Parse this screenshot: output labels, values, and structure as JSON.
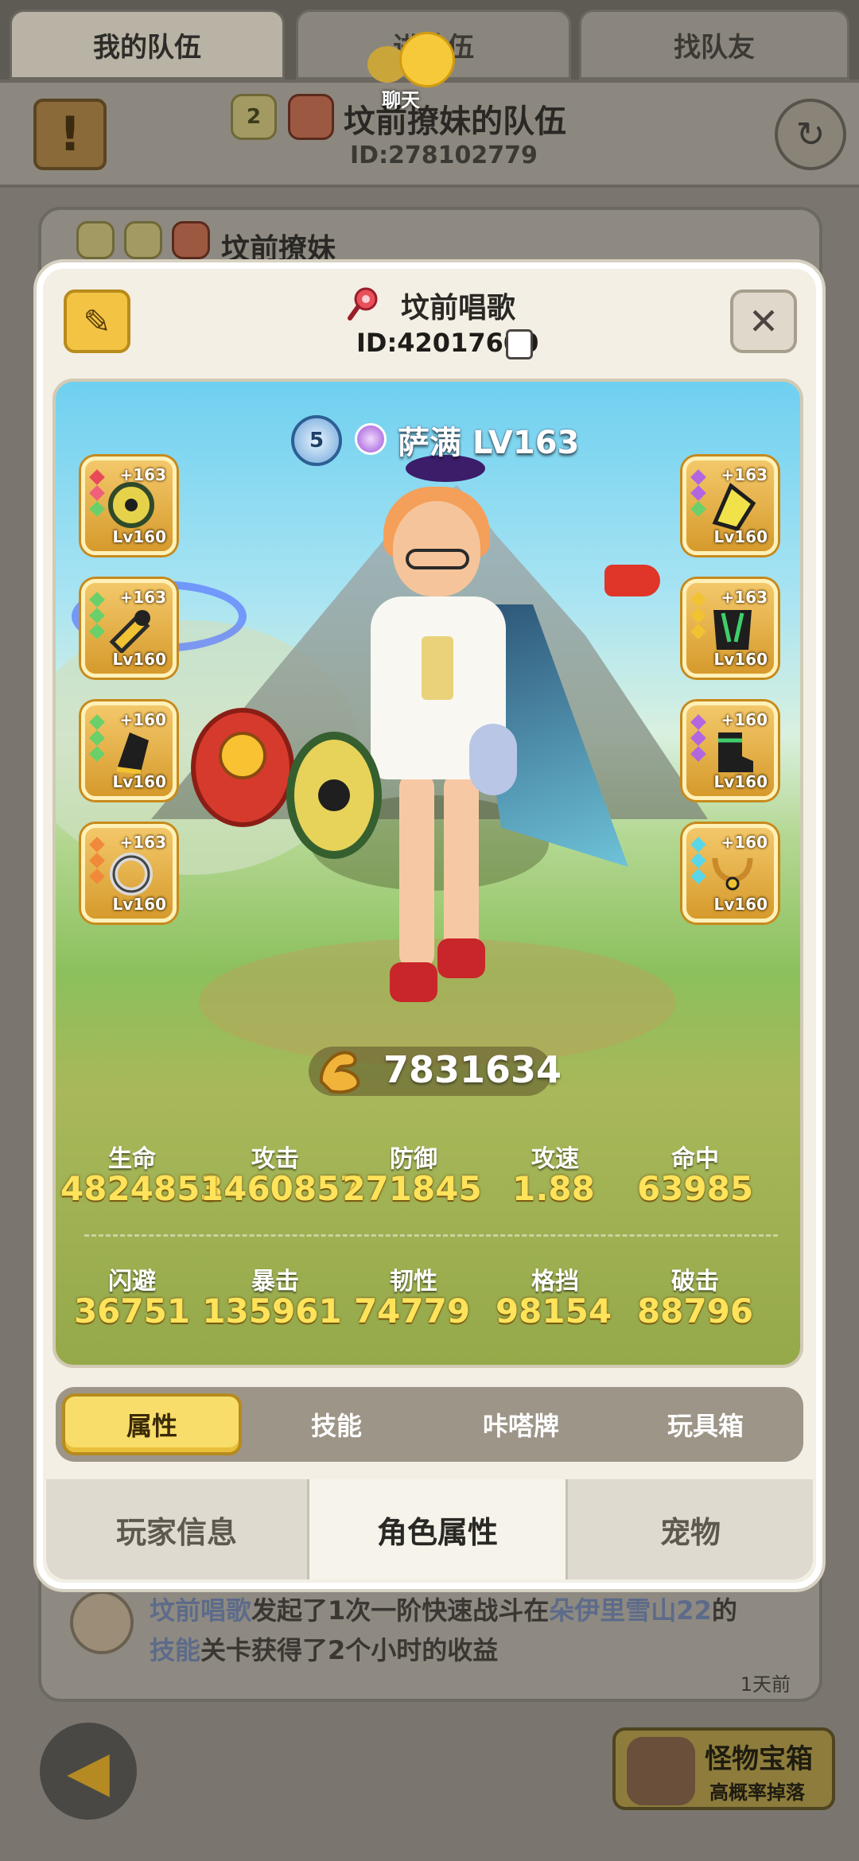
{
  "background": {
    "top_tabs": [
      "我的队伍",
      "进队伍",
      "找队友"
    ],
    "chat_label": "聊天",
    "team_badge_level": "2",
    "team_name": "坟前撩妹的队伍",
    "team_id": "ID:278102779",
    "member_name": "坟前撩妹",
    "feed": {
      "name": "坟前唱歌",
      "text1": "发起了1次一阶快速战斗在",
      "location": "朵伊里雪山22",
      "text1_end": "的",
      "text2_link": "技能",
      "text2": "关卡获得了2个小时的收益",
      "time": "1天前"
    },
    "chest": {
      "title": "怪物宝箱",
      "subtitle": "高概率掉落"
    }
  },
  "modal": {
    "char_name": "坟前唱歌",
    "char_id": "ID:42017600",
    "class_text": "萨满 LV163",
    "class_badge_number": "5",
    "power": "7831634",
    "stats_row1": [
      {
        "label": "生命",
        "value": "4824853"
      },
      {
        "label": "攻击",
        "value": "1460857"
      },
      {
        "label": "防御",
        "value": "271845"
      },
      {
        "label": "攻速",
        "value": "1.88"
      },
      {
        "label": "命中",
        "value": "63985"
      }
    ],
    "stats_row2": [
      {
        "label": "闪避",
        "value": "36751"
      },
      {
        "label": "暴击",
        "value": "135961"
      },
      {
        "label": "韧性",
        "value": "74779"
      },
      {
        "label": "格挡",
        "value": "98154"
      },
      {
        "label": "破击",
        "value": "88796"
      }
    ],
    "equipment_left": [
      {
        "plus": "+163",
        "level": "Lv160",
        "icon": "shield-gear-icon"
      },
      {
        "plus": "+163",
        "level": "Lv160",
        "icon": "weapon-gear-icon"
      },
      {
        "plus": "+160",
        "level": "Lv160",
        "icon": "gloves-gear-icon"
      },
      {
        "plus": "+163",
        "level": "Lv160",
        "icon": "ring-gear-icon"
      }
    ],
    "equipment_right": [
      {
        "plus": "+163",
        "level": "Lv160",
        "icon": "helmet-gear-icon"
      },
      {
        "plus": "+163",
        "level": "Lv160",
        "icon": "armor-gear-icon"
      },
      {
        "plus": "+160",
        "level": "Lv160",
        "icon": "boots-gear-icon"
      },
      {
        "plus": "+160",
        "level": "Lv160",
        "icon": "necklace-gear-icon"
      }
    ],
    "sub_tabs": [
      "属性",
      "技能",
      "咔嗒牌",
      "玩具箱"
    ],
    "bottom_tabs": [
      "玩家信息",
      "角色属性",
      "宠物"
    ]
  },
  "colors": {
    "stat_value": "#ffe35a",
    "active_tab": "#f8dd6a",
    "modal_bg": "#f3efe4"
  }
}
